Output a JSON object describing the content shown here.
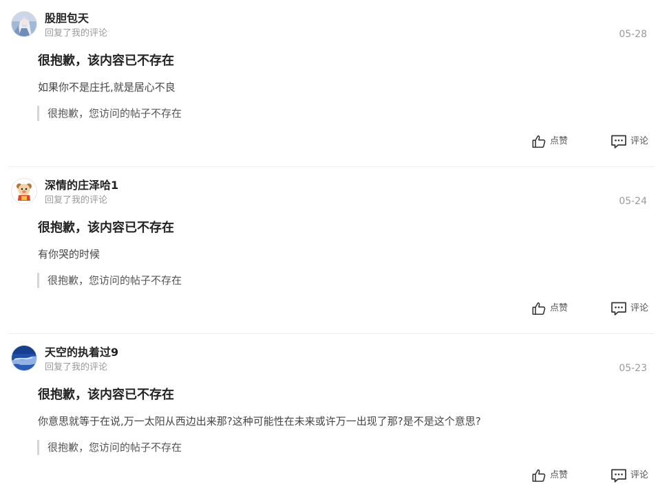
{
  "comments": [
    {
      "username": "股胆包天",
      "subtitle": "回复了我的评论",
      "date": "05-28",
      "headline": "很抱歉，该内容已不存在",
      "body": "如果你不是庄托,就是居心不良",
      "quote": "很抱歉，您访问的帖子不存在",
      "like_label": "点赞",
      "comment_label": "评论",
      "avatar_icon": "anime-character-avatar"
    },
    {
      "username": "深情的庄泽哈1",
      "subtitle": "回复了我的评论",
      "date": "05-24",
      "headline": "很抱歉，该内容已不存在",
      "body": "有你哭的时候",
      "quote": "很抱歉，您访问的帖子不存在",
      "like_label": "点赞",
      "comment_label": "评论",
      "avatar_icon": "cartoon-mascot-avatar"
    },
    {
      "username": "天空的执着过9",
      "subtitle": "回复了我的评论",
      "date": "05-23",
      "headline": "很抱歉，该内容已不存在",
      "body": "你意思就等于在说,万一太阳从西边出来那?这种可能性在未来或许万一出现了那?是不是这个意思?",
      "quote": "很抱歉，您访问的帖子不存在",
      "like_label": "点赞",
      "comment_label": "评论",
      "avatar_icon": "blue-sky-avatar"
    }
  ],
  "icons": {
    "like": "thumbs-up-icon",
    "comment": "comment-bubble-icon"
  },
  "colors": {
    "text_primary": "#222222",
    "text_secondary": "#999999",
    "quote_bar": "#d5d5d5",
    "divider": "#eeeeee"
  }
}
